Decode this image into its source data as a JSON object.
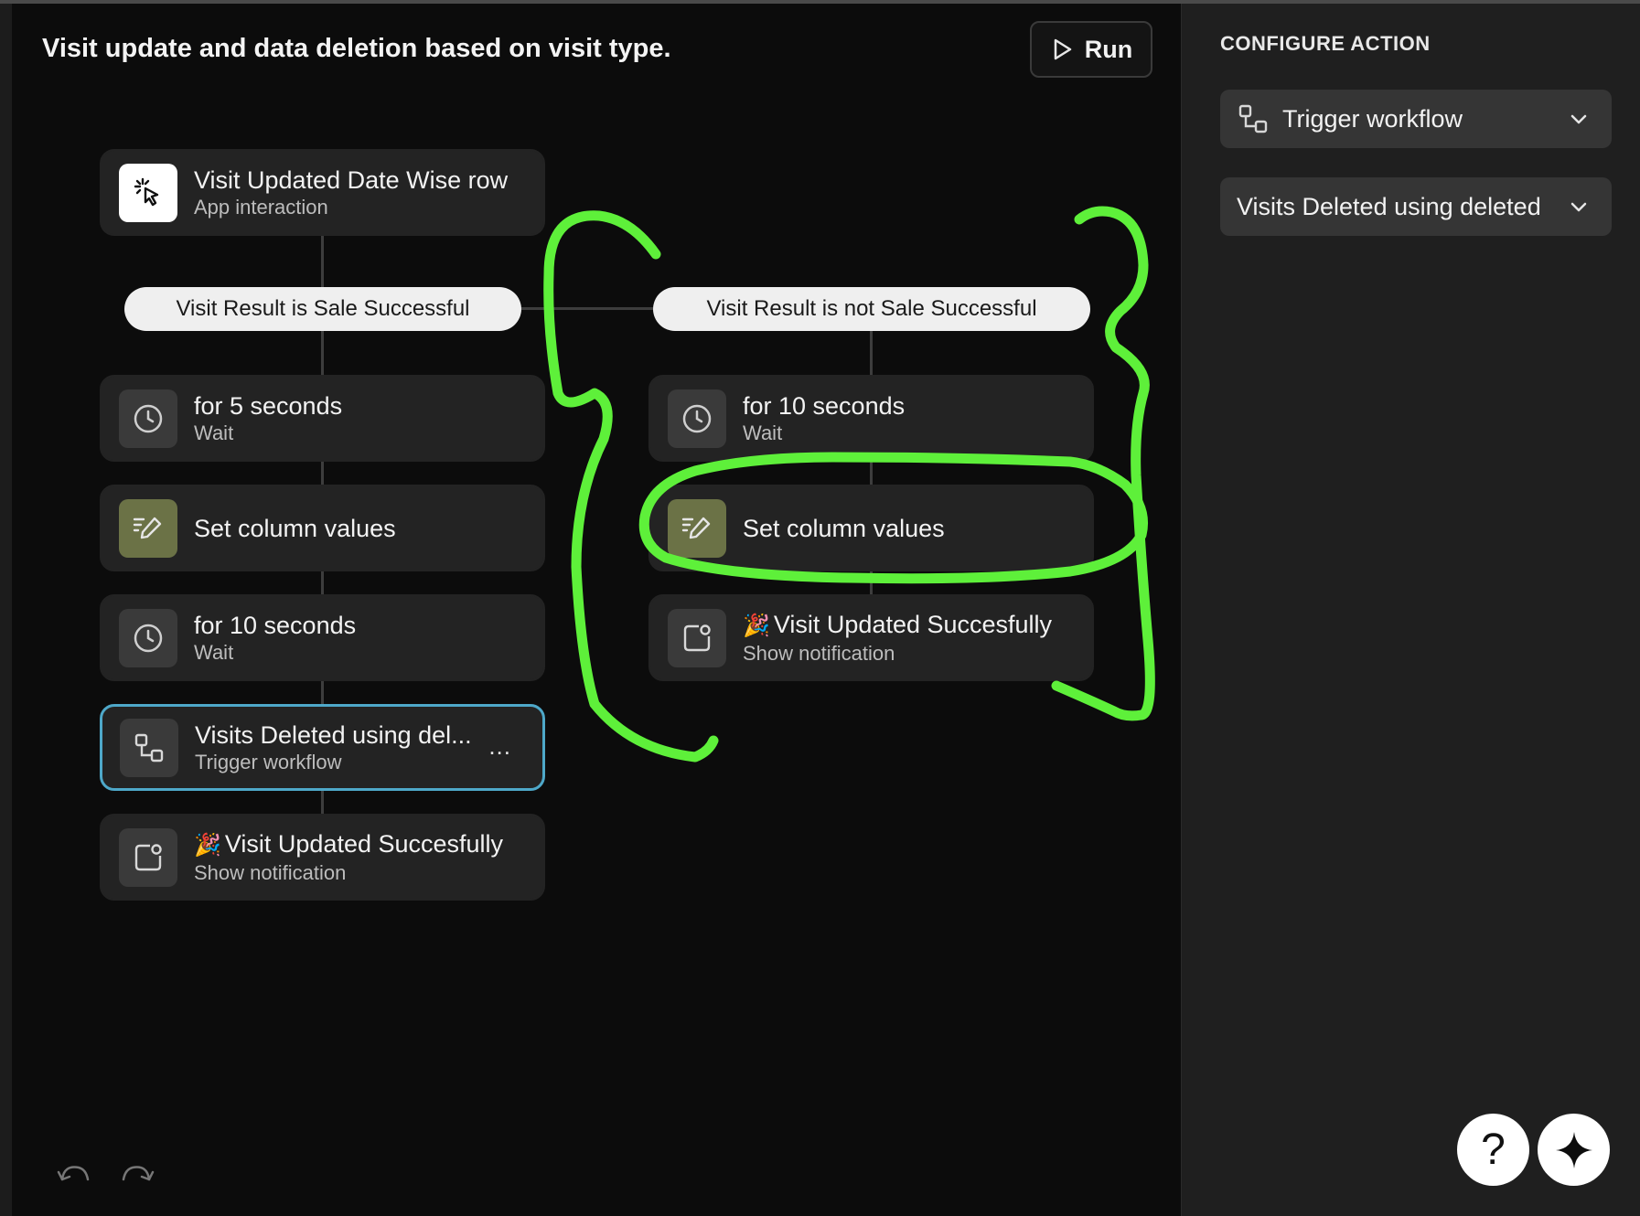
{
  "workflow": {
    "title": "Visit update and data deletion based on visit type.",
    "run_label": "Run"
  },
  "trigger_node": {
    "label": "Visit Updated Date Wise row",
    "sub": "App interaction",
    "icon": "cursor-click-icon"
  },
  "conditions": {
    "left": "Visit Result is Sale Successful",
    "right": "Visit Result is not Sale Successful"
  },
  "left_branch": [
    {
      "label": "for 5 seconds",
      "sub": "Wait",
      "icon": "clock-icon"
    },
    {
      "label": "Set column values",
      "sub": "",
      "icon": "edit-icon"
    },
    {
      "label": "for 10 seconds",
      "sub": "Wait",
      "icon": "clock-icon"
    },
    {
      "label": "Visits Deleted using del...",
      "sub": "Trigger workflow",
      "icon": "workflow-icon",
      "selected": true,
      "more": "..."
    },
    {
      "label": "Visit Updated Succesfully",
      "sub": "Show notification",
      "icon": "notification-icon",
      "emoji": "🎉"
    }
  ],
  "right_branch": [
    {
      "label": "for 10 seconds",
      "sub": "Wait",
      "icon": "clock-icon"
    },
    {
      "label": "Set column values",
      "sub": "",
      "icon": "edit-icon"
    },
    {
      "label": "Visit Updated Succesfully",
      "sub": "Show notification",
      "icon": "notification-icon",
      "emoji": "🎉"
    }
  ],
  "panel": {
    "title": "CONFIGURE ACTION",
    "action_select": "Trigger workflow",
    "workflow_select": "Visits Deleted using deleted"
  },
  "floating": {
    "help": "?"
  },
  "colors": {
    "annotation": "#5ef03a",
    "selected_border": "#4ea8c9",
    "olive_icon": "#6b7246"
  }
}
